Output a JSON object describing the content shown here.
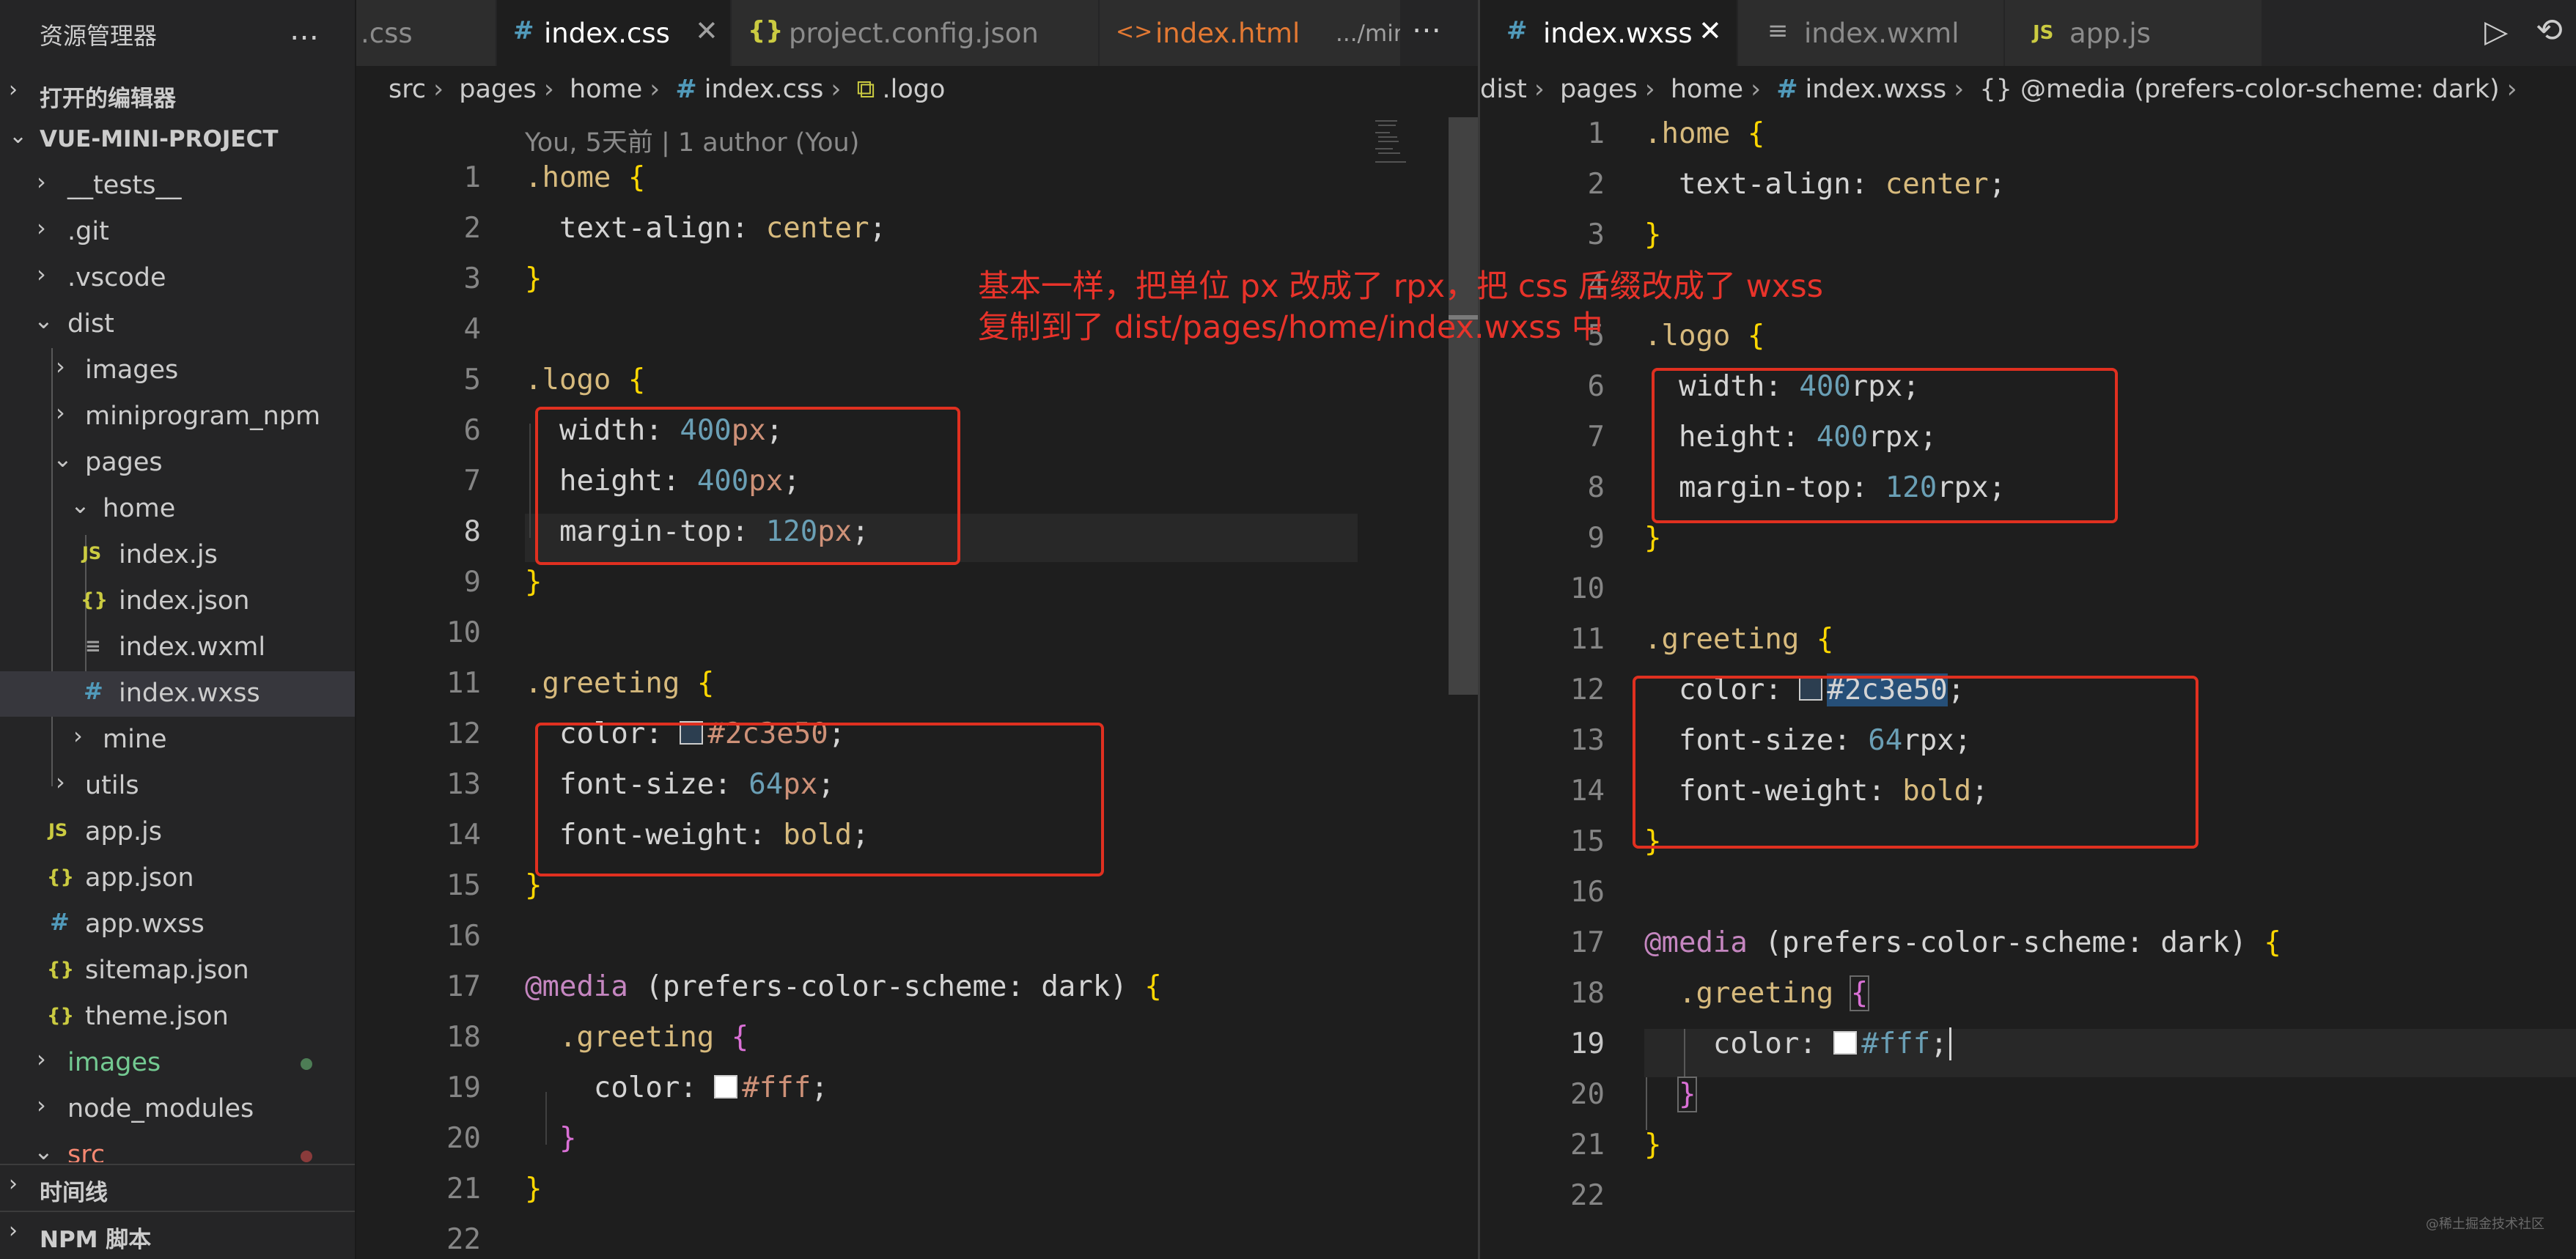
{
  "sidebar": {
    "title": "资源管理器",
    "more_icon": "…",
    "open_editors": "打开的编辑器",
    "project": "VUE-MINI-PROJECT",
    "tree": [
      {
        "name": "__tests__",
        "icon": "",
        "status": ""
      },
      {
        "name": ".git",
        "icon": "",
        "status": ""
      },
      {
        "name": ".vscode",
        "icon": "",
        "status": ""
      },
      {
        "name": "dist",
        "icon": "",
        "status": ""
      },
      {
        "name": "images",
        "icon": "",
        "status": ""
      },
      {
        "name": "miniprogram_npm",
        "icon": "",
        "status": ""
      },
      {
        "name": "pages",
        "icon": "",
        "status": ""
      },
      {
        "name": "home",
        "icon": "",
        "status": ""
      },
      {
        "name": "index.js",
        "icon": "JS",
        "status": ""
      },
      {
        "name": "index.json",
        "icon": "{}",
        "status": ""
      },
      {
        "name": "index.wxml",
        "icon": "≡",
        "status": ""
      },
      {
        "name": "index.wxss",
        "icon": "#",
        "status": ""
      },
      {
        "name": "mine",
        "icon": "",
        "status": ""
      },
      {
        "name": "utils",
        "icon": "",
        "status": ""
      },
      {
        "name": "app.js",
        "icon": "JS",
        "status": ""
      },
      {
        "name": "app.json",
        "icon": "{}",
        "status": ""
      },
      {
        "name": "app.wxss",
        "icon": "#",
        "status": ""
      },
      {
        "name": "sitemap.json",
        "icon": "{}",
        "status": ""
      },
      {
        "name": "theme.json",
        "icon": "{}",
        "status": ""
      },
      {
        "name": "images",
        "icon": "",
        "status": "modified"
      },
      {
        "name": "node_modules",
        "icon": "",
        "status": ""
      },
      {
        "name": "src",
        "icon": "",
        "status": "error"
      }
    ],
    "timeline": "时间线",
    "npm_scripts": "NPM 脚本"
  },
  "left_editor": {
    "tabs": [
      {
        "icon": "",
        "label": ".css"
      },
      {
        "icon": "#",
        "label": "index.css",
        "close": "✕"
      },
      {
        "icon": "{}",
        "label": "project.config.json"
      },
      {
        "icon": "<>",
        "label": "index.html",
        "detail": ".../min"
      }
    ],
    "more_icon": "⋯",
    "breadcrumb": [
      "src",
      "pages",
      "home",
      "index.css",
      ".logo"
    ],
    "blame": "You, 5天前 | 1 author (You)",
    "lines": [
      "1",
      "2",
      "3",
      "4",
      "5",
      "6",
      "7",
      "8",
      "9",
      "10",
      "11",
      "12",
      "13",
      "14",
      "15",
      "16",
      "17",
      "18",
      "19",
      "20",
      "21",
      "22"
    ],
    "code": {
      "home_sel": ".home",
      "text_align_prop": "text-align",
      "center": "center",
      "logo_sel": ".logo",
      "width_prop": "width",
      "height_prop": "height",
      "margin_prop": "margin-top",
      "n400": "400",
      "n120": "120",
      "px": "px",
      "greeting_sel": ".greeting",
      "color_prop": "color",
      "color_val": "#2c3e50",
      "font_size_prop": "font-size",
      "n64": "64",
      "font_weight_prop": "font-weight",
      "bold": "bold",
      "media_kw": "@media",
      "media_query": "(prefers-color-scheme: dark)",
      "white_val": "#fff"
    }
  },
  "right_editor": {
    "tabs": [
      {
        "icon": "#",
        "label": "index.wxss",
        "close": "✕"
      },
      {
        "icon": "≡",
        "label": "index.wxml"
      },
      {
        "icon": "JS",
        "label": "app.js"
      }
    ],
    "run_icon": "▷",
    "history_icon": "⟲",
    "breadcrumb": [
      "dist",
      "pages",
      "home",
      "index.wxss",
      "{} @media (prefers-color-scheme: dark)"
    ],
    "lines": [
      "1",
      "2",
      "3",
      "4",
      "5",
      "6",
      "7",
      "8",
      "9",
      "10",
      "11",
      "12",
      "13",
      "14",
      "15",
      "16",
      "17",
      "18",
      "19",
      "20",
      "21",
      "22"
    ],
    "rpx": "rpx"
  },
  "annotation": {
    "line1": "基本一样，把单位 px 改成了 rpx，把 css 后缀改成了 wxss",
    "line2": "复制到了 dist/pages/home/index.wxss 中"
  },
  "watermark": "@稀土掘金技术社区",
  "colors": {
    "annotation": "#e8332a",
    "accent_blue": "#519aba",
    "selector_gold": "#d7ba7d"
  }
}
